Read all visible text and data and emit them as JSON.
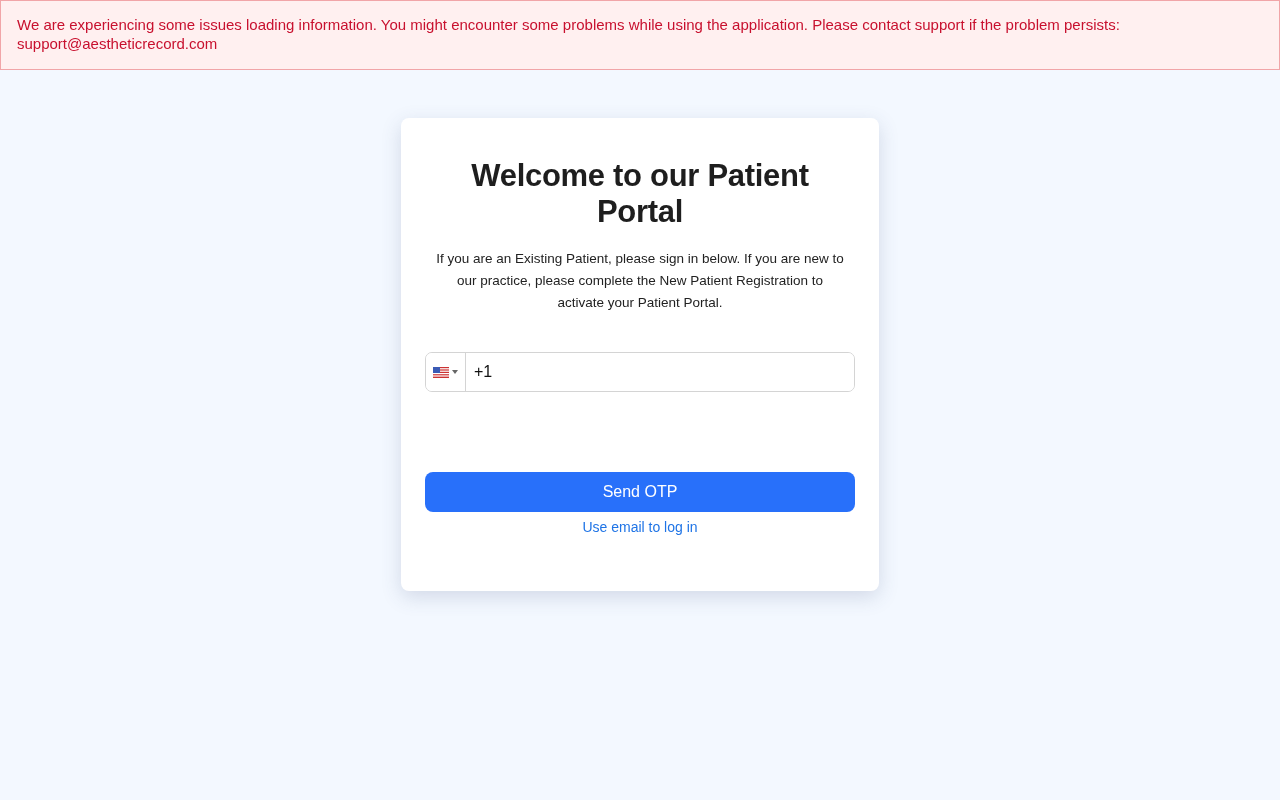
{
  "alert": {
    "message": "We are experiencing some issues loading information. You might encounter some problems while using the application. Please contact support if the problem persists: support@aestheticrecord.com"
  },
  "card": {
    "title": "Welcome to our Patient Portal",
    "intro": "If you are an Existing Patient, please sign in below. If you are new to our practice, please complete the New Patient Registration to activate your Patient Portal.",
    "phone": {
      "value": "+1"
    },
    "submit": "Send OTP",
    "alt_link": "Use email to log in"
  }
}
